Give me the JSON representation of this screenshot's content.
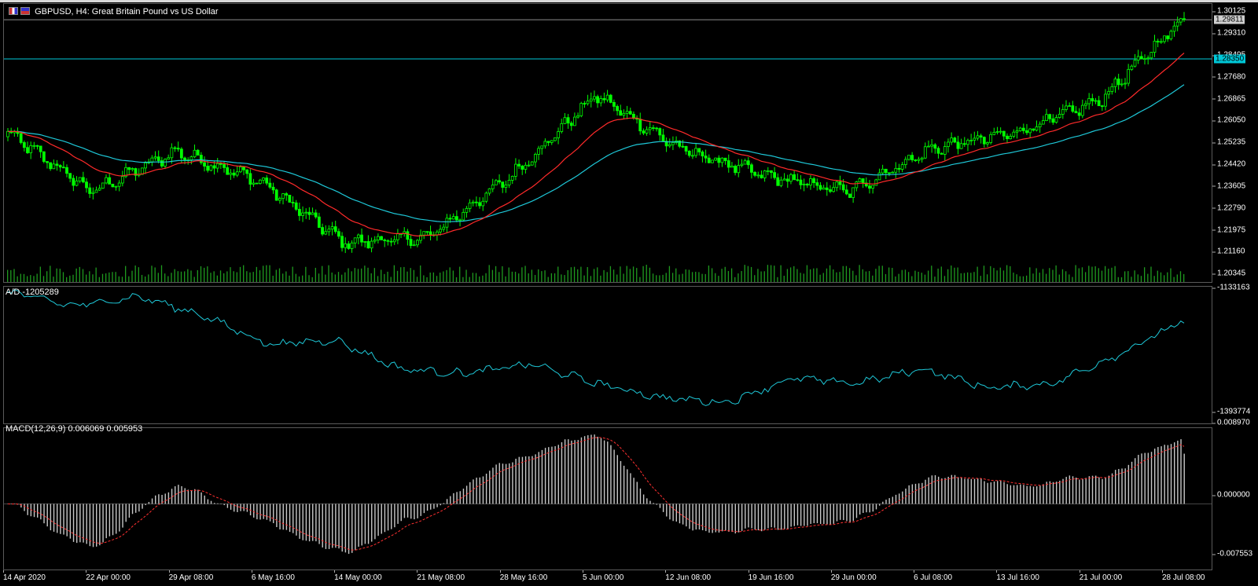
{
  "window": {
    "symbol_title": "GBPUSD, H4:  Great Britain Pound vs US Dollar"
  },
  "colors": {
    "background": "#000000",
    "bull_candle": "#00ff00",
    "volume": "#1f9a1f",
    "ma_fast": "#ff2a2a",
    "ma_slow": "#1ec8d8",
    "ad_line": "#1ec8d8",
    "macd_hist": "#c8c8c8",
    "macd_signal": "#ff3030",
    "hline_cyan": "#00c8d8",
    "hline_grey": "#8c8c8c"
  },
  "price_panel": {
    "price_levels": [
      "1.30125",
      "1.29310",
      "1.28495",
      "1.27680",
      "1.26865",
      "1.26050",
      "1.25235",
      "1.24420",
      "1.23605",
      "1.22790",
      "1.21975",
      "1.21160",
      "1.20345"
    ],
    "current_price_tag": "1.29811",
    "hline_tag": "1.28350"
  },
  "ad_panel": {
    "title": "A/D -1205289",
    "max_label": "-1133163",
    "min_label": "-1393774"
  },
  "macd_panel": {
    "title": "MACD(12,26,9) 0.006069 0.005953",
    "max_label": "0.008970",
    "zero_label": "0.000000",
    "min_label": "-0.007553"
  },
  "time_axis": [
    "14 Apr 2020",
    "22 Apr 00:00",
    "29 Apr 08:00",
    "6 May 16:00",
    "14 May 00:00",
    "21 May 08:00",
    "28 May 16:00",
    "5 Jun 00:00",
    "12 Jun 08:00",
    "19 Jun 16:00",
    "29 Jun 00:00",
    "6 Jul 08:00",
    "13 Jul 16:00",
    "21 Jul 00:00",
    "28 Jul 08:00"
  ],
  "chart_data": {
    "type": "candlestick",
    "symbol": "GBPUSD",
    "timeframe": "H4",
    "ylim": [
      1.2003,
      1.304
    ],
    "close_path": {
      "dates": [
        "14 Apr 2020",
        "22 Apr 00:00",
        "29 Apr 08:00",
        "6 May 16:00",
        "14 May 00:00",
        "21 May 08:00",
        "28 May 16:00",
        "5 Jun 00:00",
        "12 Jun 08:00",
        "19 Jun 16:00",
        "29 Jun 00:00",
        "6 Jul 08:00",
        "13 Jul 16:00",
        "21 Jul 00:00",
        "28 Jul 08:00"
      ],
      "values": [
        1.256,
        1.234,
        1.249,
        1.238,
        1.215,
        1.217,
        1.24,
        1.27,
        1.25,
        1.24,
        1.234,
        1.25,
        1.256,
        1.268,
        1.299
      ]
    },
    "current_price": 1.29811,
    "horizontal_line": 1.2835,
    "ad": {
      "ylim": [
        -1393774,
        -1133163
      ],
      "last": -1205289
    },
    "macd": {
      "ylim": [
        -0.007553,
        0.00897
      ],
      "main": 0.006069,
      "signal": 0.005953
    }
  }
}
